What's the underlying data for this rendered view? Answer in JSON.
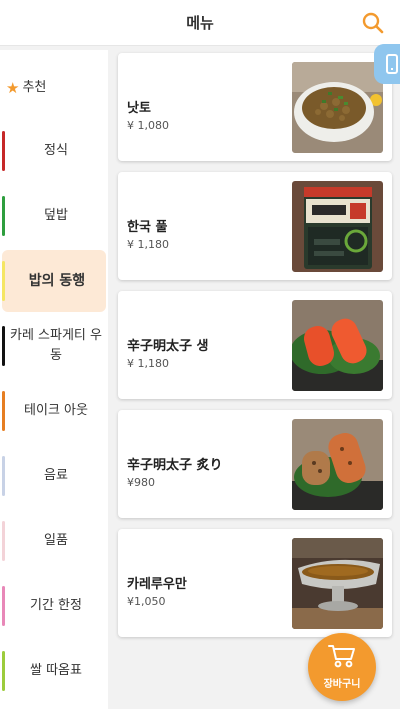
{
  "header": {
    "title": "메뉴",
    "search_icon": "search-icon"
  },
  "float_button": {
    "icon": "phone-icon",
    "color": "#8fc6ee"
  },
  "sidebar": {
    "items": [
      {
        "label": "추천",
        "icon": "star-icon",
        "color": "#f39a2e"
      },
      {
        "label": "정식",
        "color": "#c62828"
      },
      {
        "label": "덮밥",
        "color": "#2e9e3e"
      },
      {
        "label": "밥의 동행",
        "color": "#f5e663",
        "active": true
      },
      {
        "label": "카레 스파게티 우동",
        "color": "#111111"
      },
      {
        "label": "테이크 아웃",
        "color": "#e67e22"
      },
      {
        "label": "음료",
        "color": "#c8d2e6"
      },
      {
        "label": "일품",
        "color": "#f3d3d8"
      },
      {
        "label": "기간 한정",
        "color": "#e888b8"
      },
      {
        "label": "쌀 따옴표",
        "color": "#9ccc3c"
      }
    ]
  },
  "menu_items": [
    {
      "name": "낫토",
      "price": "¥ 1,080"
    },
    {
      "name": "한국 풀",
      "price": "¥ 1,180"
    },
    {
      "name": "辛子明太子 생",
      "price": "¥ 1,180"
    },
    {
      "name": "辛子明太子 炙り",
      "price": "¥980"
    },
    {
      "name": "카레루우만",
      "price": "¥1,050"
    }
  ],
  "cart": {
    "label": "장바구니",
    "icon": "cart-icon",
    "color": "#f39a2e"
  },
  "colors": {
    "accent": "#f39a2e",
    "active_bg": "#fde9d6"
  }
}
